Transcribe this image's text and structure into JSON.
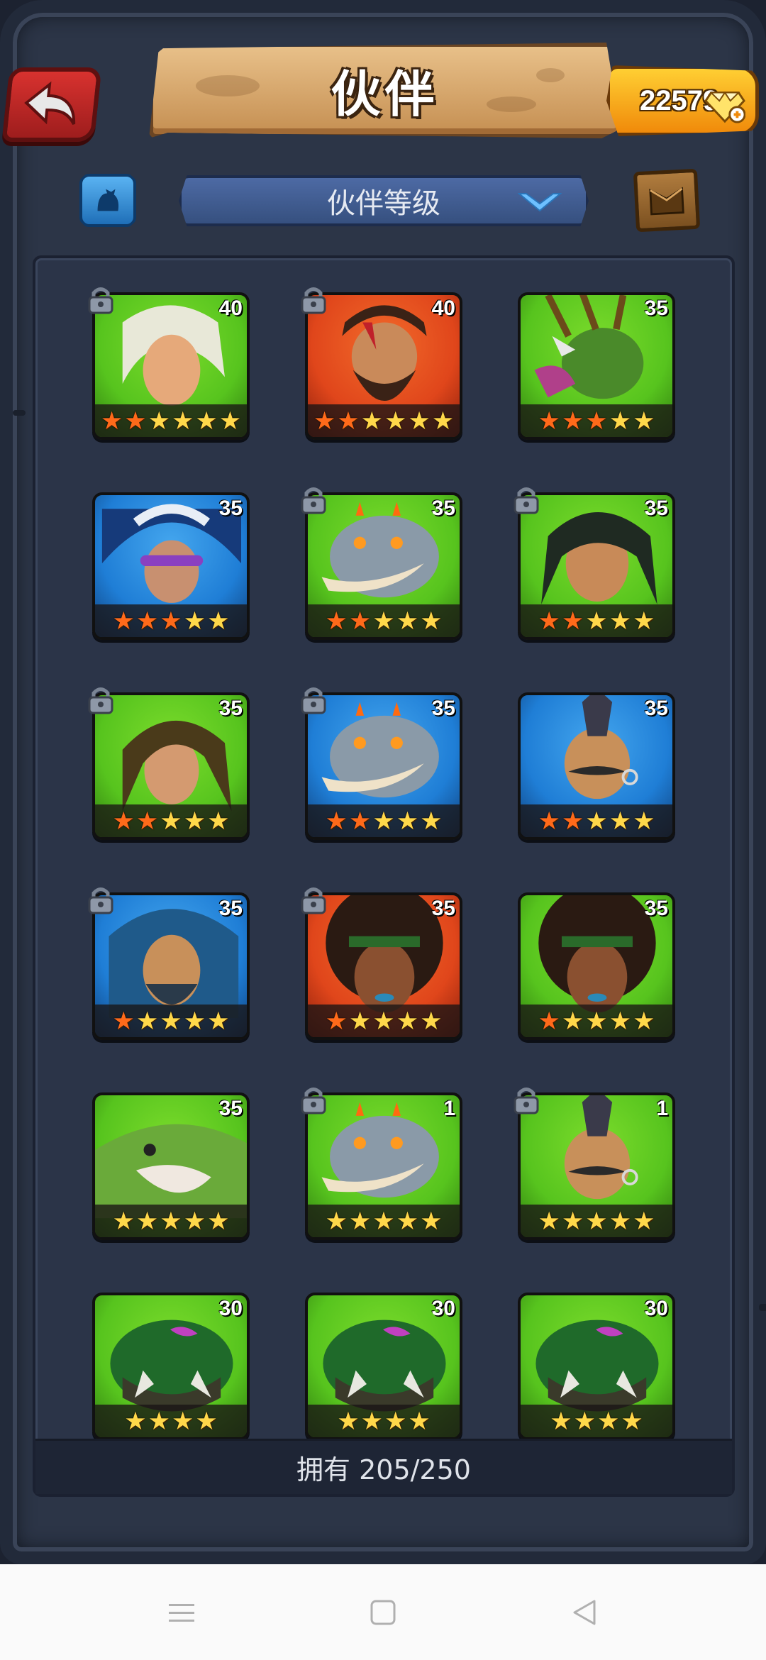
{
  "title": "伙伴",
  "currency": {
    "value": "22579",
    "icon": "gem-plus-icon"
  },
  "toolbar": {
    "filter_icon": "filter-icon",
    "sort_label": "伙伴等级",
    "map_icon": "map-icon"
  },
  "heroes": [
    {
      "level": "40",
      "stars": 6,
      "red": 2,
      "locked": true,
      "theme": "green",
      "feature": "white-hair"
    },
    {
      "level": "40",
      "stars": 6,
      "red": 2,
      "locked": true,
      "theme": "red",
      "feature": "bearded"
    },
    {
      "level": "35",
      "stars": 5,
      "red": 3,
      "locked": false,
      "theme": "green",
      "feature": "boar"
    },
    {
      "level": "35",
      "stars": 5,
      "red": 3,
      "locked": false,
      "theme": "blue",
      "feature": "wizard"
    },
    {
      "level": "35",
      "stars": 5,
      "red": 2,
      "locked": true,
      "theme": "green",
      "feature": "elephant"
    },
    {
      "level": "35",
      "stars": 5,
      "red": 2,
      "locked": true,
      "theme": "green",
      "feature": "warrior"
    },
    {
      "level": "35",
      "stars": 5,
      "red": 2,
      "locked": true,
      "theme": "green",
      "feature": "girl"
    },
    {
      "level": "35",
      "stars": 5,
      "red": 2,
      "locked": true,
      "theme": "blue",
      "feature": "elephant"
    },
    {
      "level": "35",
      "stars": 5,
      "red": 2,
      "locked": false,
      "theme": "blue",
      "feature": "dwarf"
    },
    {
      "level": "35",
      "stars": 5,
      "red": 1,
      "locked": true,
      "theme": "blue",
      "feature": "barbarian"
    },
    {
      "level": "35",
      "stars": 5,
      "red": 1,
      "locked": true,
      "theme": "red",
      "feature": "afro"
    },
    {
      "level": "35",
      "stars": 5,
      "red": 1,
      "locked": false,
      "theme": "green",
      "feature": "afro"
    },
    {
      "level": "35",
      "stars": 5,
      "red": 0,
      "locked": false,
      "theme": "green",
      "feature": "shark"
    },
    {
      "level": "1",
      "stars": 5,
      "red": 0,
      "locked": true,
      "theme": "green",
      "feature": "elephant"
    },
    {
      "level": "1",
      "stars": 5,
      "red": 0,
      "locked": true,
      "theme": "green",
      "feature": "dwarf"
    },
    {
      "level": "30",
      "stars": 4,
      "red": 0,
      "locked": false,
      "theme": "green",
      "feature": "beast"
    },
    {
      "level": "30",
      "stars": 4,
      "red": 0,
      "locked": false,
      "theme": "green",
      "feature": "beast"
    },
    {
      "level": "30",
      "stars": 4,
      "red": 0,
      "locked": false,
      "theme": "green",
      "feature": "beast"
    }
  ],
  "owned_label": "拥有 205/250",
  "colors": {
    "green_bg": "#57c41e",
    "red_bg": "#e0461b",
    "blue_bg": "#1f7ed6",
    "star_red": "#ff6a1a",
    "star_gold": "#ffd84a"
  },
  "nav": {
    "menu_icon": "menu-icon",
    "home_icon": "home-square-icon",
    "back_icon": "back-triangle-icon"
  }
}
